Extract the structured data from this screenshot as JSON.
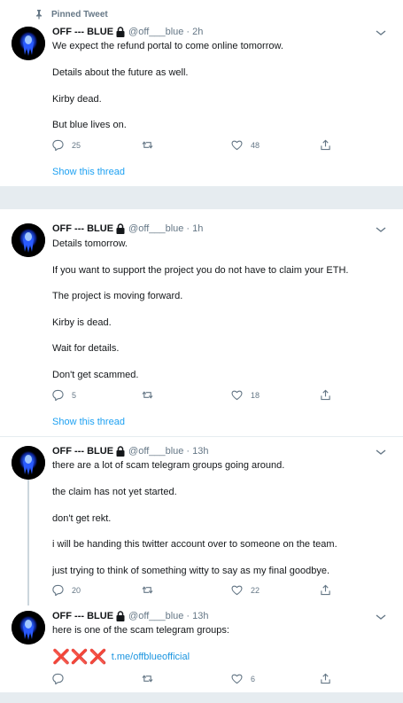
{
  "tweets": [
    {
      "pinned_label": "Pinned Tweet",
      "author_name": "OFF --- BLUE",
      "handle": "@off___blue",
      "dot": "·",
      "time": "2h",
      "lines": [
        "We expect the refund portal to come online tomorrow.",
        "Details about the future as well.",
        "Kirby dead.",
        "But blue lives on."
      ],
      "replies": "25",
      "retweets": "",
      "likes": "48",
      "show_thread": "Show this thread"
    },
    {
      "author_name": "OFF --- BLUE",
      "handle": "@off___blue",
      "dot": "·",
      "time": "1h",
      "lines": [
        "Details tomorrow.",
        "If you want to support the project you do not have to claim your ETH.",
        "The project is moving forward.",
        "Kirby is dead.",
        "Wait for details.",
        "Don't get scammed."
      ],
      "replies": "5",
      "retweets": "",
      "likes": "18",
      "show_thread": "Show this thread"
    },
    {
      "author_name": "OFF --- BLUE",
      "handle": "@off___blue",
      "dot": "·",
      "time": "13h",
      "lines": [
        "there are a lot of scam telegram groups going around.",
        "the claim has not yet started.",
        "don't get rekt.",
        "i will be handing this twitter account over to someone on the team.",
        "just trying to think of something witty to say as my final goodbye."
      ],
      "replies": "20",
      "retweets": "",
      "likes": "22"
    },
    {
      "author_name": "OFF --- BLUE",
      "handle": "@off___blue",
      "dot": "·",
      "time": "13h",
      "lines": [
        "here is one of the scam telegram groups:"
      ],
      "x_marks": "❌❌❌",
      "link": "t.me/offblueofficial",
      "replies": "",
      "retweets": "",
      "likes": "6"
    }
  ],
  "icons": {
    "pin": "pin-icon",
    "lock": "lock-icon",
    "caret": "caret-down-icon",
    "reply": "reply-icon",
    "retweet": "retweet-icon",
    "like": "heart-icon",
    "share": "share-icon"
  },
  "colors": {
    "link_blue": "#1da1f2",
    "secondary_text": "#657786",
    "separator": "#e6ecf0",
    "avatar_glow": "#1e5cff"
  }
}
